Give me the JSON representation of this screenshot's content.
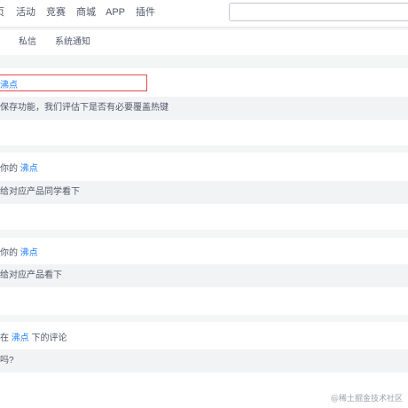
{
  "topnav": {
    "items": [
      "页",
      "活动",
      "竞赛",
      "商城",
      "APP",
      "插件"
    ]
  },
  "search": {
    "value": "",
    "placeholder": ""
  },
  "subnav": {
    "items": [
      "私信",
      "系统通知"
    ]
  },
  "notifications": [
    {
      "prefix": "",
      "link": "沸点",
      "suffix": "",
      "quote": "保存功能，我们评估下是否有必要覆盖热键"
    },
    {
      "prefix": "你的 ",
      "link": "沸点",
      "suffix": "",
      "quote": "给对应产品同学看下"
    },
    {
      "prefix": "你的 ",
      "link": "沸点",
      "suffix": "",
      "quote": "给对应产品看下"
    },
    {
      "prefix": "在 ",
      "link": "沸点",
      "suffix": " 下的评论",
      "quote": "吗?"
    }
  ],
  "watermark": "@稀土掘金技术社区",
  "colors": {
    "link": "#1e80ff",
    "highlight": "#e5484d"
  }
}
